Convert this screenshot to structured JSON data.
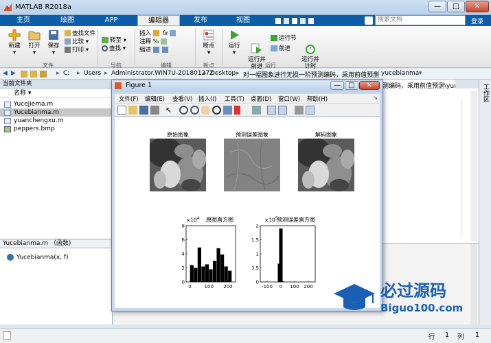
{
  "window": {
    "title": "MATLAB R2018a",
    "min": "—",
    "max": "□",
    "close": "✕"
  },
  "tabs": [
    {
      "label": "主页",
      "active": false
    },
    {
      "label": "绘图",
      "active": false
    },
    {
      "label": "APP",
      "active": false
    },
    {
      "label": "编辑器",
      "active": true
    },
    {
      "label": "发布",
      "active": false
    },
    {
      "label": "视图",
      "active": false
    }
  ],
  "search": {
    "placeholder": "搜索文档",
    "login": "登录"
  },
  "ribbon": {
    "new": "新建",
    "open": "打开",
    "save": "保存",
    "find_files": "查找文件",
    "compare": "比较",
    "print": "打印",
    "file_group": "文件",
    "insert": "插入",
    "fx": "fx",
    "comment": "注释",
    "indent": "缩进",
    "goto": "转至",
    "find": "查找",
    "nav_group": "导航",
    "edit_group": "编辑",
    "breakpoints": "断点",
    "bp_group": "断点",
    "run": "运行",
    "run_advance": "运行并\n前进",
    "run_section": "运行节",
    "advance": "前进",
    "run_time": "运行并\n计时",
    "run_group": "运行"
  },
  "address": {
    "parts": [
      "C:",
      "Users",
      "Administrator.WIN7U-20180127Z",
      "Desktop",
      "对一幅图象进行无损一阶预测编码，采用前值预测",
      "yucebianma"
    ],
    "behind_figure": "测编码，采用前值预测\\yuc..."
  },
  "current_folder": {
    "title": "当前文件夹",
    "column": "名称",
    "files": [
      {
        "name": "Yucejiema.m",
        "selected": false
      },
      {
        "name": "Yucebianma.m",
        "selected": true
      },
      {
        "name": "yuanchengxu.m",
        "selected": false
      },
      {
        "name": "peppers.bmp",
        "selected": false
      }
    ]
  },
  "details": {
    "title": "Yucebianma.m （函数)",
    "signature": "Yucebianma(x, f)"
  },
  "right_panel_label": "工作区",
  "status": {
    "row_label": "行",
    "row": "1",
    "col_label": "列",
    "col": "1"
  },
  "figure": {
    "title": "Figure 1",
    "menu": [
      "文件(F)",
      "编辑(E)",
      "查看(V)",
      "插入(I)",
      "工具(T)",
      "桌面(D)",
      "窗口(W)",
      "帮助(H)"
    ],
    "images": [
      {
        "title": "原始图象"
      },
      {
        "title": "预测误差图象"
      },
      {
        "title": "解码图象"
      }
    ],
    "hist1": {
      "title": "原图直方图",
      "exp": "×10",
      "pow": "4",
      "yticks": [
        "0",
        "2",
        "4",
        "6",
        "8"
      ],
      "xticks": [
        "0",
        "100",
        "200"
      ]
    },
    "hist2": {
      "title": "预测误差直方图",
      "exp": "×10",
      "pow": "5",
      "yticks": [
        "0",
        "0.5",
        "1",
        "1.5",
        "2"
      ],
      "xticks": [
        "-100",
        "0",
        "100",
        "200"
      ]
    }
  },
  "chart_data": [
    {
      "type": "bar",
      "title": "原图直方图",
      "x": [
        10,
        30,
        50,
        70,
        90,
        110,
        130,
        150,
        170,
        190,
        210
      ],
      "values": [
        2.4,
        2.0,
        4.9,
        2.2,
        2.5,
        1.8,
        3.0,
        4.8,
        3.9,
        2.2,
        1.6
      ],
      "ylim": [
        0,
        8
      ],
      "xlim": [
        -20,
        240
      ],
      "y_scale": "×10^4"
    },
    {
      "type": "bar",
      "title": "预测误差直方图",
      "x": [
        -10,
        0,
        10
      ],
      "values": [
        0.65,
        1.9,
        0.02
      ],
      "ylim": [
        0,
        2
      ],
      "xlim": [
        -150,
        250
      ],
      "y_scale": "×10^5"
    }
  ],
  "watermark": {
    "text": "必过源码",
    "url": "Biguo100.com"
  }
}
